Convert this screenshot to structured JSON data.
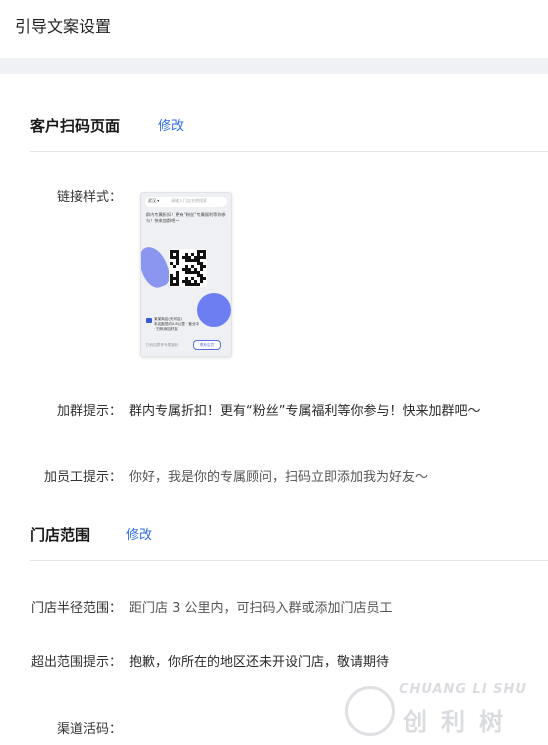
{
  "header": {
    "title": "引导文案设置"
  },
  "scan_section": {
    "title": "客户扫码页面",
    "edit_label": "修改",
    "link_style_label": "链接样式：",
    "preview": {
      "city": "武汉 ▾",
      "search_placeholder": "请输入门店名称搜索",
      "greeting": "群内专属折扣！更有“粉丝”专属福利等你参与！快来加群吧～",
      "store_name": "某某商店(天河店)",
      "store_info": "本店距您约0.8公里 · 营业中 · 扫码添加好友",
      "foot_text": "扫码加群享专属福利",
      "button_label": "联系店员"
    },
    "group_tip_label": "加群提示：",
    "group_tip_value": "群内专属折扣！更有“粉丝”专属福利等你参与！快来加群吧～",
    "staff_tip_label": "加员工提示：",
    "staff_tip_value": "你好，我是你的专属顾问，扫码立即添加我为好友～"
  },
  "store_section": {
    "title": "门店范围",
    "edit_label": "修改",
    "radius_label": "门店半径范围：",
    "radius_value": "距门店 3 公里内，可扫码入群或添加门店员工",
    "out_range_label": "超出范围提示：",
    "out_range_value": "抱歉，你所在的地区还未开设门店，敬请期待",
    "channel_code_label": "渠道活码："
  },
  "watermark": {
    "en": "CHUANG LI SHU",
    "cn": "创利树"
  },
  "colors": {
    "link": "#2e6be6",
    "band": "#f0f1f4",
    "accent": "#6d7ef2"
  }
}
